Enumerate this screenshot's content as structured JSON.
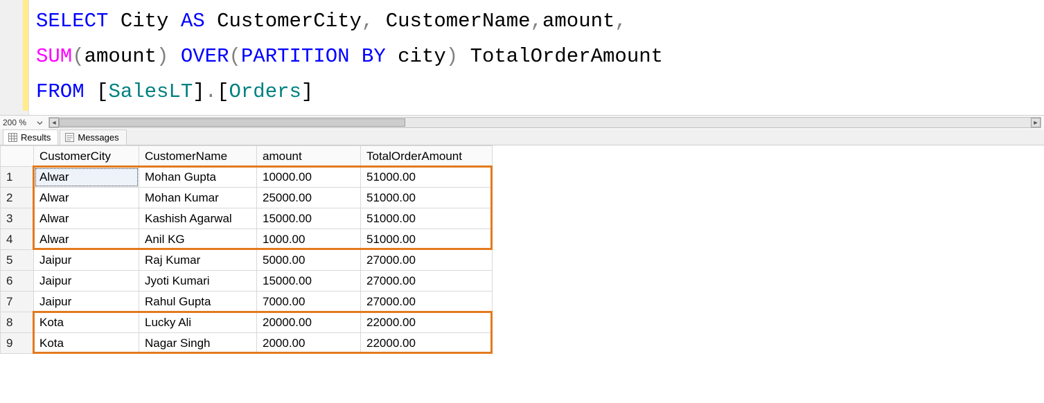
{
  "sql": {
    "line1": {
      "select": "SELECT",
      "city": "City",
      "as": "AS",
      "customerCity": "CustomerCity",
      "comma1": ",",
      "customerName": "CustomerName",
      "comma2": ",",
      "amount": "amount",
      "comma3": ","
    },
    "line2": {
      "sum": "SUM",
      "open1": "(",
      "amount": "amount",
      "close1": ")",
      "over": "OVER",
      "open2": "(",
      "partitionBy": "PARTITION BY",
      "city": "city",
      "close2": ")",
      "alias": "TotalOrderAmount"
    },
    "line3": {
      "from": "FROM",
      "schemaOpen": "[",
      "schema": "SalesLT",
      "schemaClose": "]",
      "dot": ".",
      "tblOpen": "[",
      "tbl": "Orders",
      "tblClose": "]"
    }
  },
  "zoom": "200 %",
  "tabs": {
    "results": "Results",
    "messages": "Messages"
  },
  "columns": [
    "CustomerCity",
    "CustomerName",
    "amount",
    "TotalOrderAmount"
  ],
  "rows": [
    {
      "n": "1",
      "city": "Alwar",
      "name": "Mohan Gupta",
      "amount": "10000.00",
      "total": "51000.00"
    },
    {
      "n": "2",
      "city": "Alwar",
      "name": "Mohan Kumar",
      "amount": "25000.00",
      "total": "51000.00"
    },
    {
      "n": "3",
      "city": "Alwar",
      "name": "Kashish Agarwal",
      "amount": "15000.00",
      "total": "51000.00"
    },
    {
      "n": "4",
      "city": "Alwar",
      "name": "Anil KG",
      "amount": "1000.00",
      "total": "51000.00"
    },
    {
      "n": "5",
      "city": "Jaipur",
      "name": "Raj Kumar",
      "amount": "5000.00",
      "total": "27000.00"
    },
    {
      "n": "6",
      "city": "Jaipur",
      "name": "Jyoti Kumari",
      "amount": "15000.00",
      "total": "27000.00"
    },
    {
      "n": "7",
      "city": "Jaipur",
      "name": "Rahul Gupta",
      "amount": "7000.00",
      "total": "27000.00"
    },
    {
      "n": "8",
      "city": "Kota",
      "name": "Lucky Ali",
      "amount": "20000.00",
      "total": "22000.00"
    },
    {
      "n": "9",
      "city": "Kota",
      "name": "Nagar Singh",
      "amount": "2000.00",
      "total": "22000.00"
    }
  ]
}
